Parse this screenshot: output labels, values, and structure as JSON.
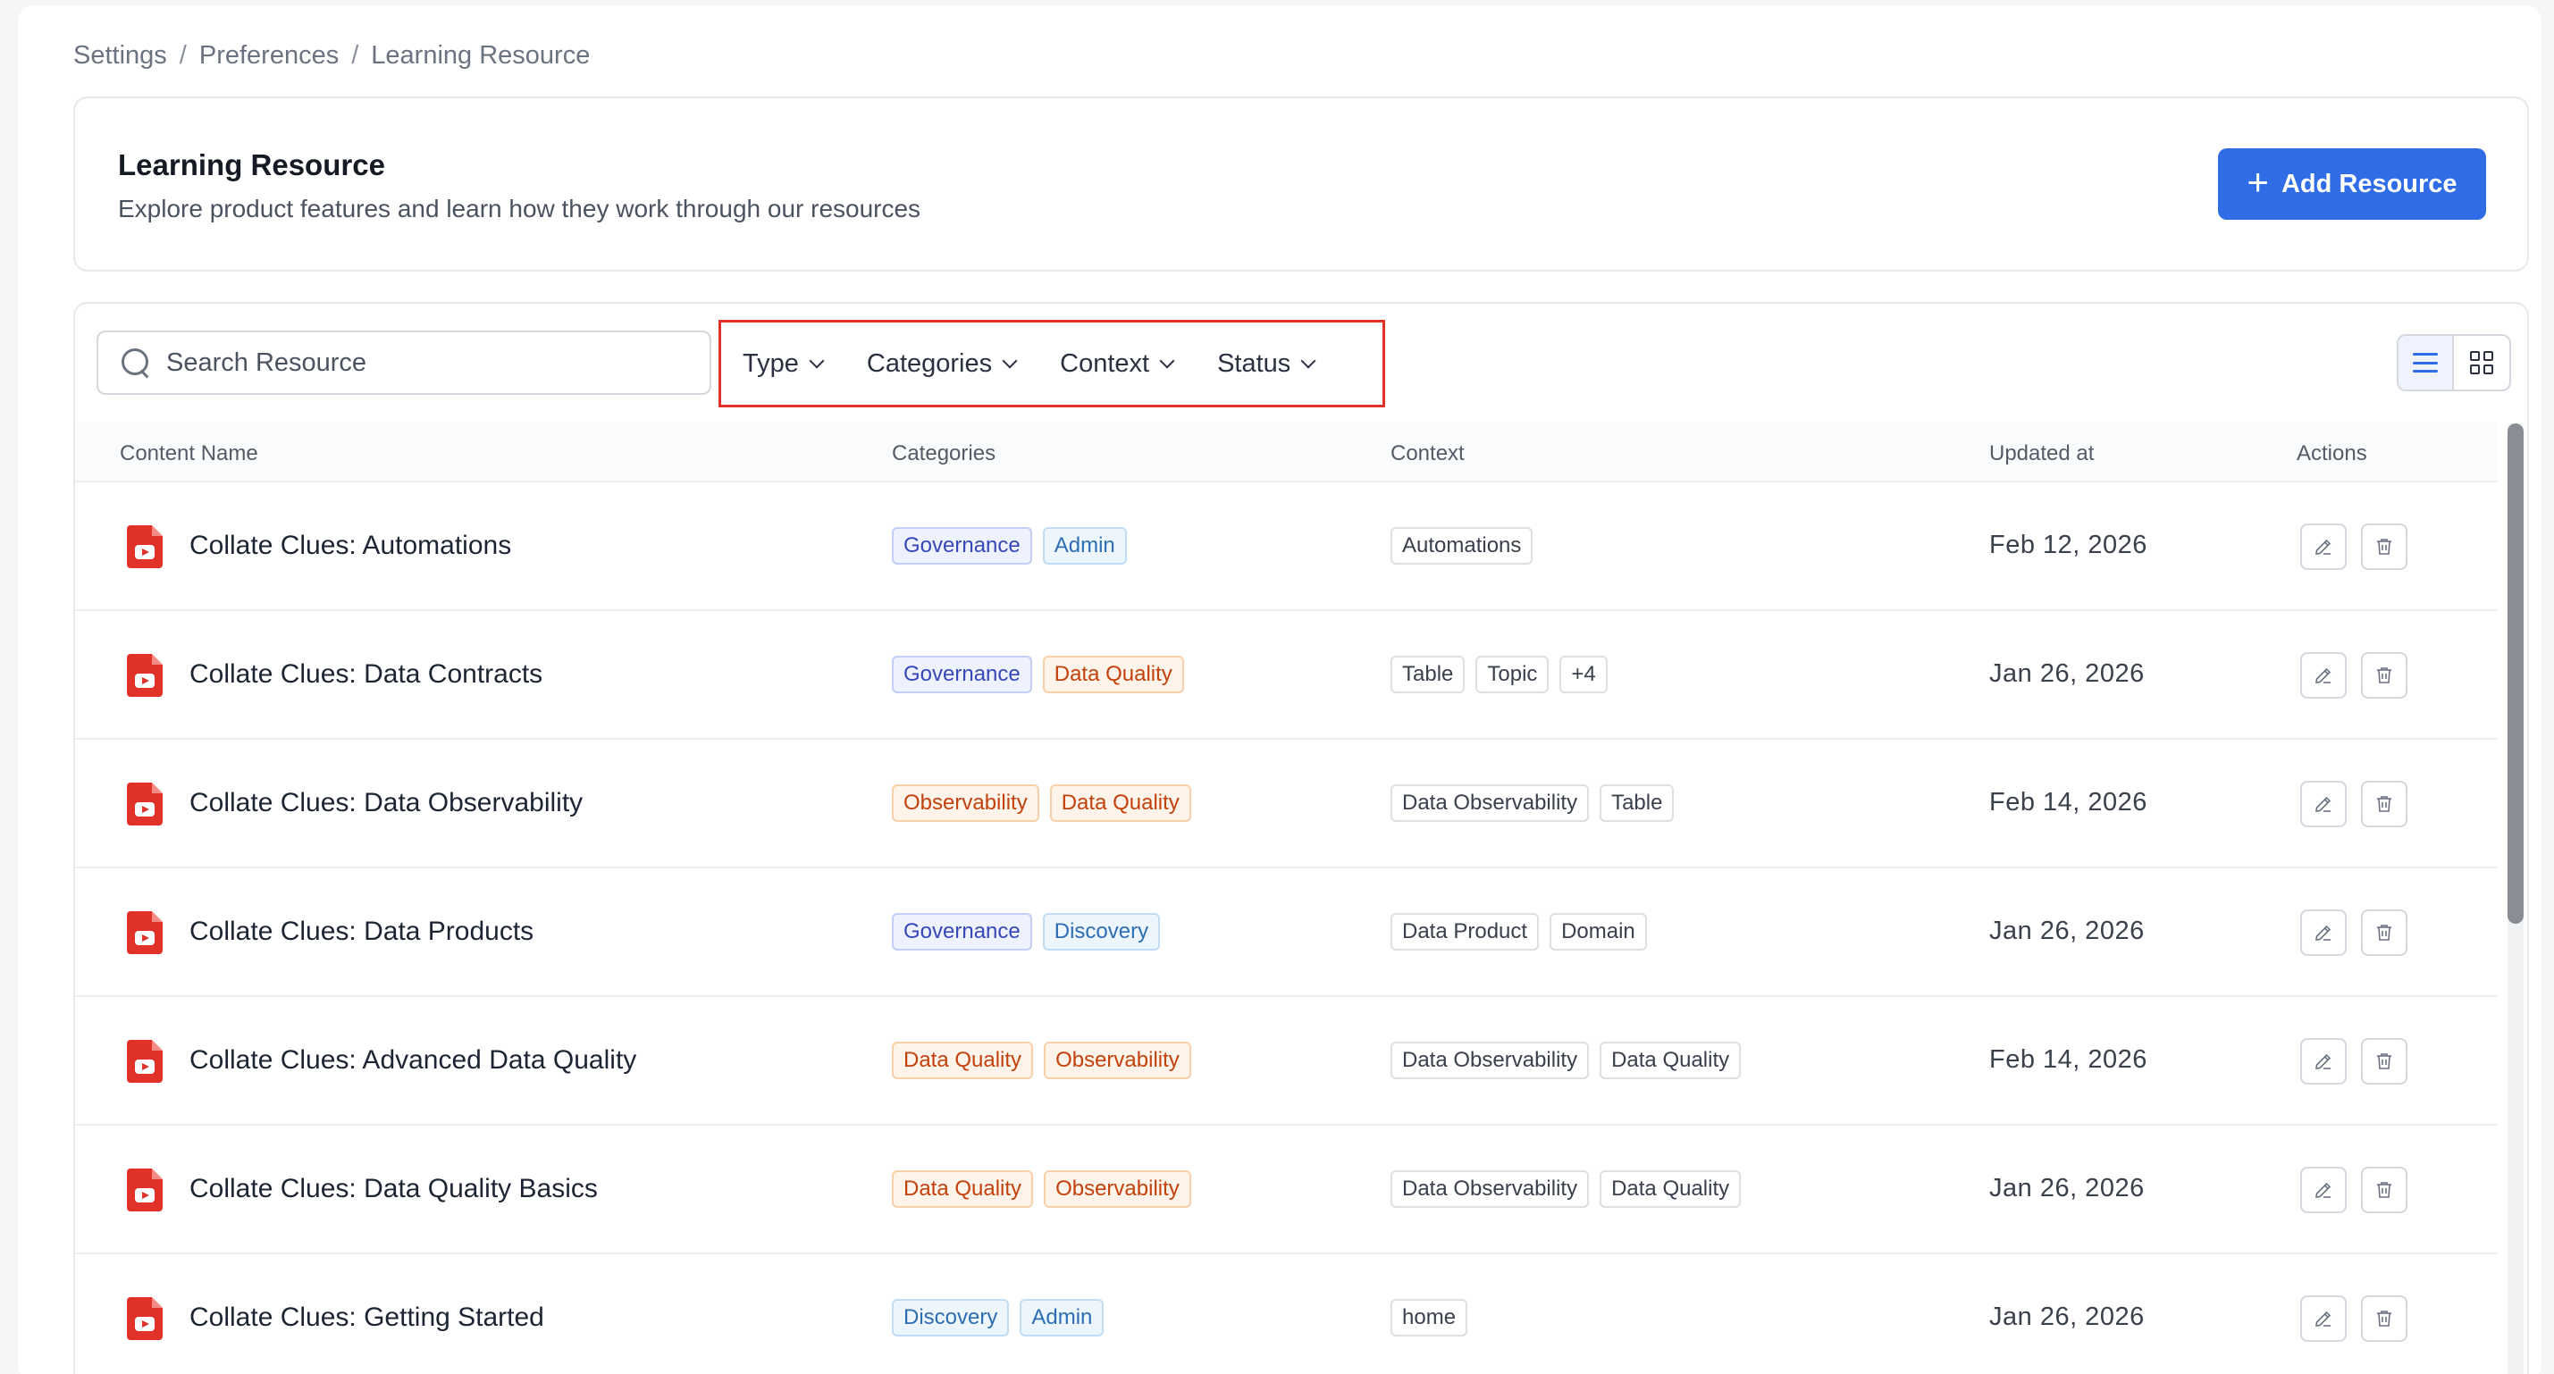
{
  "breadcrumb": [
    "Settings",
    "Preferences",
    "Learning Resource"
  ],
  "header": {
    "title": "Learning Resource",
    "subtitle": "Explore product features and learn how they work through our resources",
    "add_button": "Add Resource"
  },
  "search": {
    "placeholder": "Search Resource"
  },
  "filters": [
    "Type",
    "Categories",
    "Context",
    "Status"
  ],
  "table": {
    "columns": [
      "Content Name",
      "Categories",
      "Context",
      "Updated at",
      "Actions"
    ],
    "rows": [
      {
        "name": "Collate Clues: Automations",
        "categories": [
          {
            "label": "Governance",
            "style": "blue"
          },
          {
            "label": "Admin",
            "style": "lightblue"
          }
        ],
        "context": [
          "Automations"
        ],
        "updated": "Feb 12, 2026"
      },
      {
        "name": "Collate Clues: Data Contracts",
        "categories": [
          {
            "label": "Governance",
            "style": "blue"
          },
          {
            "label": "Data Quality",
            "style": "orange"
          }
        ],
        "context": [
          "Table",
          "Topic",
          "+4"
        ],
        "updated": "Jan 26, 2026"
      },
      {
        "name": "Collate Clues: Data Observability",
        "categories": [
          {
            "label": "Observability",
            "style": "orange"
          },
          {
            "label": "Data Quality",
            "style": "orange"
          }
        ],
        "context": [
          "Data Observability",
          "Table"
        ],
        "updated": "Feb 14, 2026"
      },
      {
        "name": "Collate Clues: Data Products",
        "categories": [
          {
            "label": "Governance",
            "style": "blue"
          },
          {
            "label": "Discovery",
            "style": "lightblue"
          }
        ],
        "context": [
          "Data Product",
          "Domain"
        ],
        "updated": "Jan 26, 2026"
      },
      {
        "name": "Collate Clues: Advanced Data Quality",
        "categories": [
          {
            "label": "Data Quality",
            "style": "orange"
          },
          {
            "label": "Observability",
            "style": "orange"
          }
        ],
        "context": [
          "Data Observability",
          "Data Quality"
        ],
        "updated": "Feb 14, 2026"
      },
      {
        "name": "Collate Clues: Data Quality Basics",
        "categories": [
          {
            "label": "Data Quality",
            "style": "orange"
          },
          {
            "label": "Observability",
            "style": "orange"
          }
        ],
        "context": [
          "Data Observability",
          "Data Quality"
        ],
        "updated": "Jan 26, 2026"
      },
      {
        "name": "Collate Clues: Getting Started",
        "categories": [
          {
            "label": "Discovery",
            "style": "lightblue"
          },
          {
            "label": "Admin",
            "style": "lightblue"
          }
        ],
        "context": [
          "home"
        ],
        "updated": "Jan 26, 2026"
      }
    ]
  },
  "icons": {
    "resource_type": "video-file-icon",
    "edit": "edit-icon",
    "delete": "trash-icon"
  },
  "colors": {
    "accent": "#2f6ce5",
    "highlight_border": "#e0322b"
  }
}
